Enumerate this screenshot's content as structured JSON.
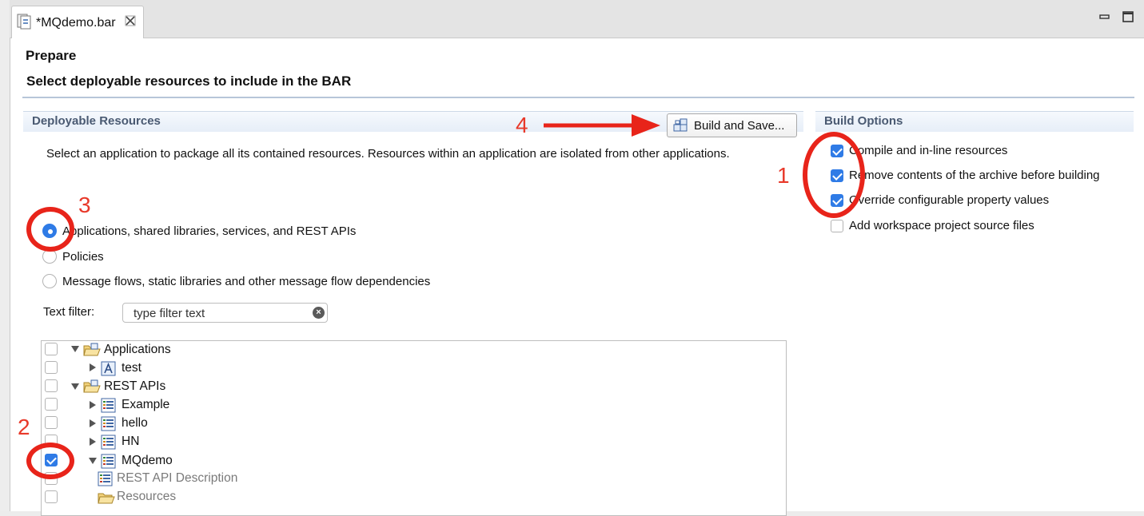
{
  "editor_tab": {
    "title": "*MQdemo.bar"
  },
  "header": {
    "title": "Prepare",
    "subtitle": "Select deployable resources to include in the BAR"
  },
  "deployable": {
    "section_title": "Deployable Resources",
    "build_button_label": "Build and Save...",
    "description": "Select an application to package all its contained resources. Resources within an application are isolated from other applications.",
    "radio_options": [
      {
        "label": "Applications, shared libraries, services, and REST APIs",
        "selected": true
      },
      {
        "label": "Policies",
        "selected": false
      },
      {
        "label": "Message flows, static libraries and other message flow dependencies",
        "selected": false
      }
    ],
    "filter_label": "Text filter:",
    "filter_placeholder": "type filter text"
  },
  "tree": [
    {
      "label": "Applications",
      "checked": false,
      "expanded": true,
      "kind": "folder"
    },
    {
      "label": "test",
      "checked": false,
      "expanded": false,
      "kind": "app"
    },
    {
      "label": "REST APIs",
      "checked": false,
      "expanded": true,
      "kind": "folder"
    },
    {
      "label": "Example",
      "checked": false,
      "expanded": false,
      "kind": "api"
    },
    {
      "label": "hello",
      "checked": false,
      "expanded": false,
      "kind": "api"
    },
    {
      "label": "HN",
      "checked": false,
      "expanded": false,
      "kind": "api"
    },
    {
      "label": "MQdemo",
      "checked": true,
      "expanded": true,
      "kind": "api"
    },
    {
      "label": "REST API Description",
      "checked": false,
      "kind": "api-desc"
    },
    {
      "label": "Resources",
      "checked": false,
      "kind": "folder-open"
    }
  ],
  "build_options": {
    "section_title": "Build Options",
    "items": [
      {
        "label": "Compile and in-line resources",
        "checked": true
      },
      {
        "label": "Remove contents of the archive before building",
        "checked": true
      },
      {
        "label": "Override configurable property values",
        "checked": true
      },
      {
        "label": "Add workspace project source files",
        "checked": false
      }
    ]
  },
  "annotations": {
    "n1": "1",
    "n2": "2",
    "n3": "3",
    "n4": "4"
  },
  "colors": {
    "accent": "#2f7be6",
    "annotation": "#e8241a",
    "section_title": "#4a5a72"
  }
}
